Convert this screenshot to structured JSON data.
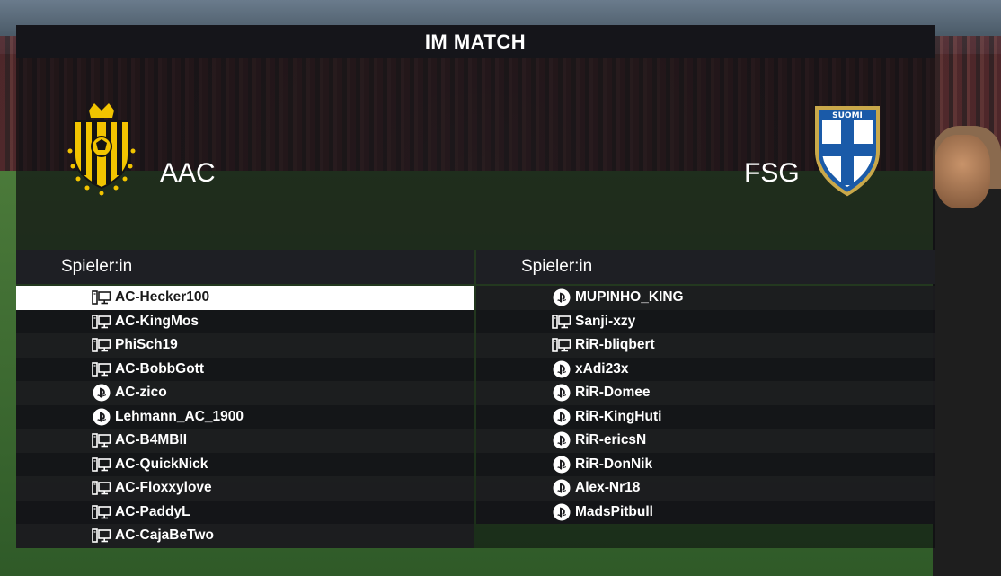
{
  "header": {
    "title": "IM MATCH"
  },
  "teams": {
    "home": {
      "name": "AAC",
      "crest_colors": [
        "#f2c400",
        "#141414"
      ]
    },
    "away": {
      "name": "FSG",
      "crest_text": "SUOMI",
      "crest_colors": [
        "#1a5aa8",
        "#ffffff",
        "#c9a84a"
      ]
    }
  },
  "columns": {
    "home_label": "Spieler:in",
    "away_label": "Spieler:in"
  },
  "home_players": [
    {
      "name": "AC-Hecker100",
      "platform": "pc-icon",
      "selected": true
    },
    {
      "name": "AC-KingMos",
      "platform": "pc-icon"
    },
    {
      "name": "PhiSch19",
      "platform": "pc-icon"
    },
    {
      "name": "AC-BobbGott",
      "platform": "pc-icon"
    },
    {
      "name": "AC-zico",
      "platform": "playstation-icon"
    },
    {
      "name": "Lehmann_AC_1900",
      "platform": "playstation-icon"
    },
    {
      "name": "AC-B4MBII",
      "platform": "pc-icon"
    },
    {
      "name": "AC-QuickNick",
      "platform": "pc-icon"
    },
    {
      "name": "AC-Floxxylove",
      "platform": "pc-icon"
    },
    {
      "name": "AC-PaddyL",
      "platform": "pc-icon"
    },
    {
      "name": "AC-CajaBeTwo",
      "platform": "pc-icon"
    }
  ],
  "away_players": [
    {
      "name": "MUPINHO_KING",
      "platform": "playstation-icon"
    },
    {
      "name": "Sanji-xzy",
      "platform": "pc-icon"
    },
    {
      "name": "RiR-bliqbert",
      "platform": "pc-icon"
    },
    {
      "name": "xAdi23x",
      "platform": "playstation-icon"
    },
    {
      "name": "RiR-Domee",
      "platform": "playstation-icon"
    },
    {
      "name": "RiR-KingHuti",
      "platform": "playstation-icon"
    },
    {
      "name": "RiR-ericsN",
      "platform": "playstation-icon"
    },
    {
      "name": "RiR-DonNik",
      "platform": "playstation-icon"
    },
    {
      "name": "Alex-Nr18",
      "platform": "playstation-icon"
    },
    {
      "name": "MadsPitbull",
      "platform": "playstation-icon"
    }
  ]
}
